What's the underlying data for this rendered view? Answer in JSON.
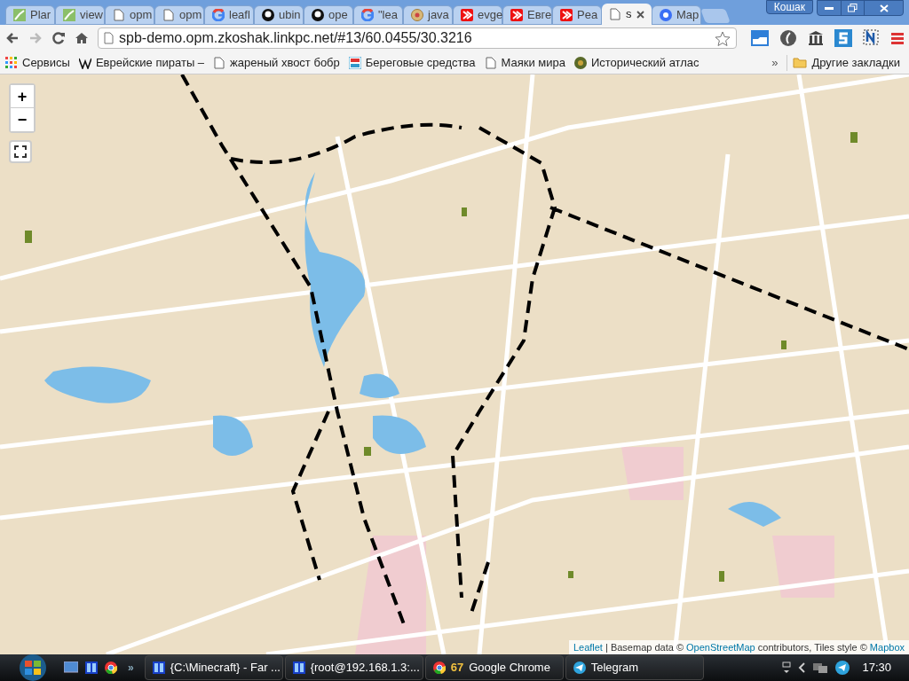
{
  "window": {
    "profile": "Кошак"
  },
  "tabs": [
    {
      "label": "Plar",
      "kind": "map",
      "selected": false
    },
    {
      "label": "view",
      "kind": "map",
      "selected": false
    },
    {
      "label": "opm",
      "kind": "doc",
      "selected": false
    },
    {
      "label": "opm",
      "kind": "doc",
      "selected": false
    },
    {
      "label": "leafl",
      "kind": "google",
      "selected": false
    },
    {
      "label": "ubin",
      "kind": "github",
      "selected": false
    },
    {
      "label": "ope",
      "kind": "github",
      "selected": false
    },
    {
      "label": "\"lea",
      "kind": "google",
      "selected": false
    },
    {
      "label": "java",
      "kind": "globe",
      "selected": false
    },
    {
      "label": "evge",
      "kind": "red",
      "selected": false
    },
    {
      "label": "Евге",
      "kind": "red",
      "selected": false
    },
    {
      "label": "Pea",
      "kind": "red",
      "selected": false
    },
    {
      "label": "s",
      "kind": "doc",
      "selected": true
    },
    {
      "label": "Map",
      "kind": "circle",
      "selected": false
    }
  ],
  "address": {
    "value": "spb-demo.opm.zkoshak.linkpc.net/#13/60.0455/30.3216"
  },
  "bookmarks": [
    {
      "label": "Сервисы",
      "kind": "apps"
    },
    {
      "label": "Еврейские пираты –",
      "kind": "wiki"
    },
    {
      "label": "жареный хвост бобр",
      "kind": "doc"
    },
    {
      "label": "Береговые средства",
      "kind": "abc"
    },
    {
      "label": "Маяки мира",
      "kind": "doc"
    },
    {
      "label": "Исторический атлас",
      "kind": "atlas"
    }
  ],
  "bookmarks_more": "»",
  "other_bookmarks": "Другие закладки",
  "map": {
    "zoom_in": "+",
    "zoom_out": "−",
    "attribution": [
      {
        "kind": "link",
        "text": "Leaflet"
      },
      {
        "kind": "text",
        "text": " | Basemap data © "
      },
      {
        "kind": "link",
        "text": "OpenStreetMap"
      },
      {
        "kind": "text",
        "text": " contributors, Tiles style © "
      },
      {
        "kind": "link",
        "text": "Mapbox"
      }
    ]
  },
  "taskbar": {
    "more": "»",
    "tasks": [
      {
        "label": "{C:\\Minecraft} - Far ...",
        "kind": "far"
      },
      {
        "label": "{root@192.168.1.3:...",
        "kind": "far"
      },
      {
        "label": "Google Chrome",
        "count": "67",
        "kind": "chrome"
      },
      {
        "label": "Telegram",
        "kind": "telegram"
      }
    ],
    "clock": "17:30"
  }
}
